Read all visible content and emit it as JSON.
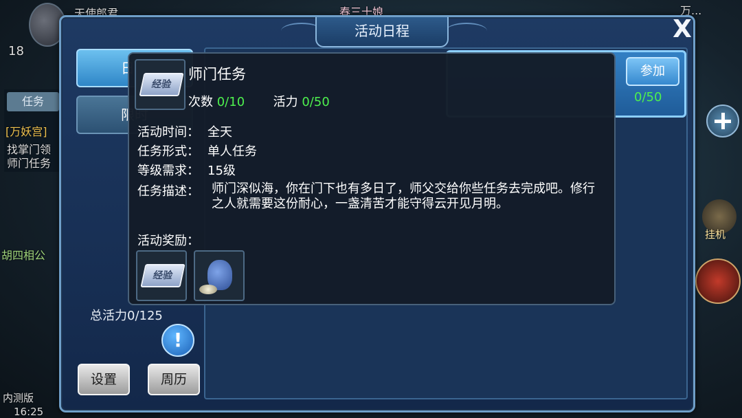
{
  "background": {
    "top_left_name": "天使郎君",
    "level": "18",
    "top_center_name": "春三十娘",
    "top_right_name": "万...",
    "sidebar_task_tab": "任务",
    "sidebar_task_group": "[万妖宫]",
    "sidebar_task_line1": "找掌门领",
    "sidebar_task_line2": "师门任务",
    "npc_name": "胡四相公",
    "afk_label": "挂机",
    "test_label": "内测版",
    "time": "16:25"
  },
  "panel": {
    "title": "活动日程",
    "close_label": "X",
    "tabs": [
      {
        "label": "日常",
        "active": true
      },
      {
        "label": "限时",
        "active": false
      }
    ],
    "total_vitality": "总活力0/125",
    "info_label": "!",
    "settings_label": "设置",
    "calendar_label": "周历",
    "card_join_label": "参加",
    "card_vitality": "0/50"
  },
  "tooltip": {
    "name": "师门任务",
    "count_label": "次数",
    "count_value": "0/10",
    "vitality_label": "活力",
    "vitality_value": "0/50",
    "fields": [
      {
        "label": "活动时间：",
        "value": "全天"
      },
      {
        "label": "任务形式：",
        "value": "单人任务"
      },
      {
        "label": "等级需求：",
        "value": "15级"
      }
    ],
    "desc_label": "任务描述：",
    "description": "师门深似海，你在门下也有多日了，师父交给你些任务去完成吧。修行之人就需要这份耐心，一盏清苦才能守得云开见月明。",
    "reward_label": "活动奖励：",
    "exp_ticket_text": "经验"
  }
}
